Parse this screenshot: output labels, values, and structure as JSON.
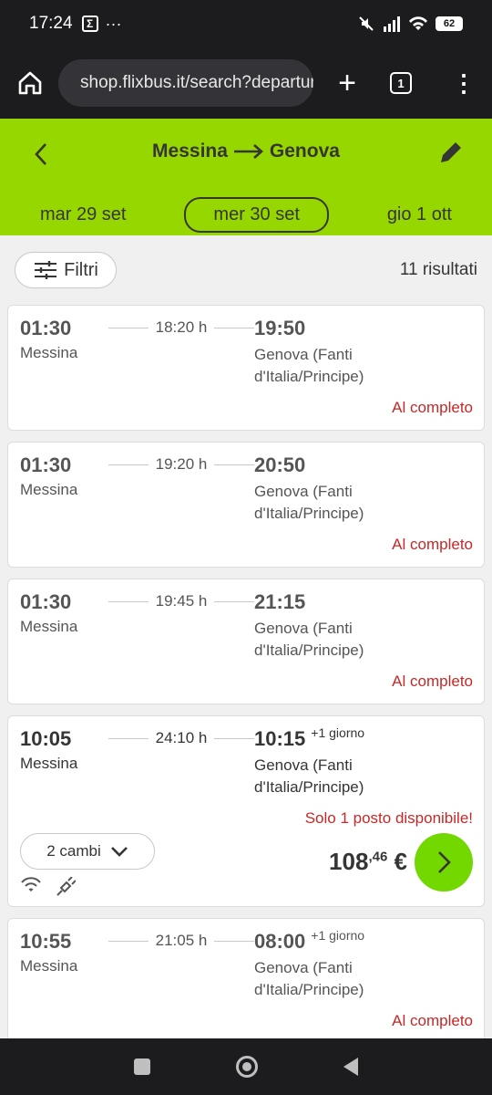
{
  "status_bar": {
    "time": "17:24",
    "battery": "62"
  },
  "browser": {
    "url": "shop.flixbus.it/search?departure",
    "tab_count": "1"
  },
  "header": {
    "from": "Messina",
    "to": "Genova"
  },
  "dates": {
    "prev": "mar 29 set",
    "selected": "mer 30 set",
    "next": "gio 1 ott"
  },
  "toolbar": {
    "filter_label": "Filtri",
    "results": "11 risultati"
  },
  "trips": [
    {
      "dep_time": "01:30",
      "duration": "18:20 h",
      "arr_time": "19:50",
      "next_day": "",
      "dep_city": "Messina",
      "arr_city": "Genova (Fanti d'Italia/Principe)",
      "status": "Al completo"
    },
    {
      "dep_time": "01:30",
      "duration": "19:20 h",
      "arr_time": "20:50",
      "next_day": "",
      "dep_city": "Messina",
      "arr_city": "Genova (Fanti d'Italia/Principe)",
      "status": "Al completo"
    },
    {
      "dep_time": "01:30",
      "duration": "19:45 h",
      "arr_time": "21:15",
      "next_day": "",
      "dep_city": "Messina",
      "arr_city": "Genova (Fanti d'Italia/Principe)",
      "status": "Al completo"
    },
    {
      "dep_time": "10:05",
      "duration": "24:10 h",
      "arr_time": "10:15",
      "next_day": "+1 giorno",
      "dep_city": "Messina",
      "arr_city": "Genova (Fanti d'Italia/Principe)",
      "status": "Solo 1 posto disponibile!",
      "changes": "2 cambi",
      "price_int": "108",
      "price_dec": ",46",
      "currency": "€"
    },
    {
      "dep_time": "10:55",
      "duration": "21:05 h",
      "arr_time": "08:00",
      "next_day": "+1 giorno",
      "dep_city": "Messina",
      "arr_city": "Genova (Fanti d'Italia/Principe)",
      "status": "Al completo"
    }
  ],
  "colors": {
    "brand_green": "#97d700",
    "button_green": "#73d700",
    "soldout_red": "#c62828"
  }
}
